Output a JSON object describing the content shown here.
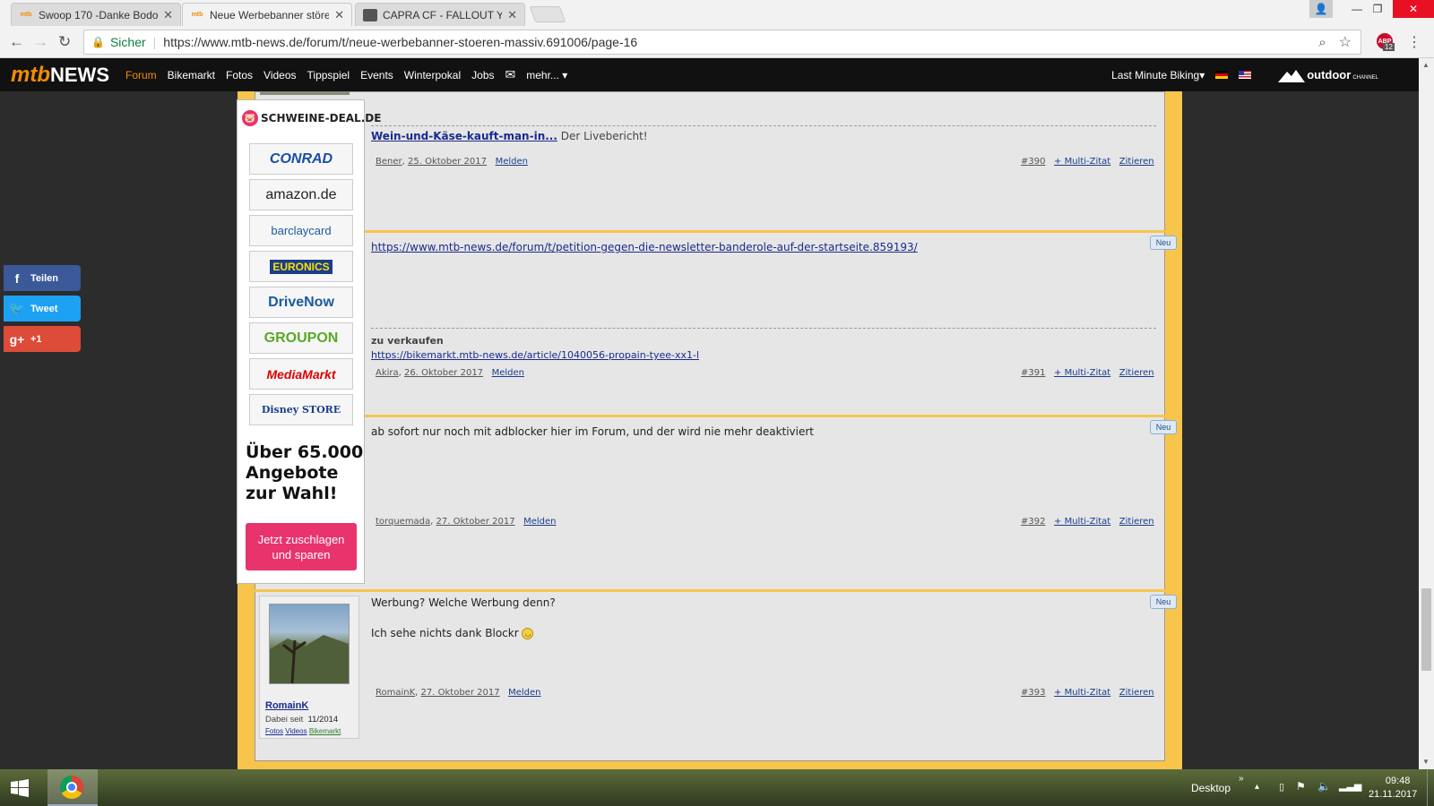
{
  "tabs": [
    {
      "title": "Swoop 170 -Danke Bodo",
      "icon": "mtb-icon",
      "active": false
    },
    {
      "title": "Neue Werbebanner störe",
      "icon": "mtb-icon",
      "active": true
    },
    {
      "title": "CAPRA CF - FALLOUT YE",
      "icon": "page-icon",
      "active": false
    }
  ],
  "address": {
    "secure_label": "Sicher",
    "url": "https://www.mtb-news.de/forum/t/neue-werbebanner-stoeren-massiv.691006/page-16",
    "abp_badge": "12"
  },
  "site_nav": {
    "logo_part1": "mtb",
    "logo_part2": "NEWS",
    "items": [
      "Forum",
      "Bikemarkt",
      "Fotos",
      "Videos",
      "Tippspiel",
      "Events",
      "Winterpokal",
      "Jobs"
    ],
    "more": "mehr...",
    "right_link": "Last Minute Biking",
    "outdoor": "outdoor",
    "outdoor_sub": "CHANNEL"
  },
  "social": [
    {
      "label": "Teilen",
      "icon": "facebook-icon",
      "glyph": "f",
      "color": "#3b5998"
    },
    {
      "label": "Tweet",
      "icon": "twitter-icon",
      "glyph": "🐦",
      "color": "#1da1f2"
    },
    {
      "label": "+1",
      "icon": "googleplus-icon",
      "glyph": "g+",
      "color": "#dd4b39"
    }
  ],
  "ad": {
    "header": "SCHWEINE-DEAL.DE",
    "brands": [
      "CONRAD",
      "amazon.de",
      "barclaycard",
      "EURONICS",
      "DriveNow",
      "GROUPON",
      "MediaMarkt",
      "Disney STORE"
    ],
    "headline_1": "Über 65.000",
    "headline_2": "Angebote",
    "headline_3": "zur Wahl!",
    "cta": "Jetzt zuschlagen und sparen"
  },
  "posts": [
    {
      "sig_link": "Wein-und-Käse-kauft-man-in...",
      "sig_text": "Der Livebericht!",
      "author": "Bener",
      "date": "25. Oktober 2017",
      "report": "Melden",
      "number": "#390",
      "multi": "+ Multi-Zitat",
      "quote": "Zitieren"
    },
    {
      "badge": "Neu",
      "link": "https://www.mtb-news.de/forum/t/petition-gegen-die-newsletter-banderole-auf-der-startseite.859193/",
      "sig_title": "zu verkaufen",
      "sig_link": "https://bikemarkt.mtb-news.de/article/1040056-propain-tyee-xx1-l",
      "author": "Akira",
      "date": "26. Oktober 2017",
      "report": "Melden",
      "number": "#391",
      "multi": "+ Multi-Zitat",
      "quote": "Zitieren"
    },
    {
      "badge": "Neu",
      "text": "ab sofort nur noch mit adblocker hier im Forum, und der wird nie mehr deaktiviert",
      "author": "torquemada",
      "date": "27. Oktober 2017",
      "report": "Melden",
      "number": "#392",
      "multi": "+ Multi-Zitat",
      "quote": "Zitieren"
    },
    {
      "badge": "Neu",
      "line1": "Werbung? Welche Werbung denn?",
      "line2": "Ich sehe nichts dank Blockr",
      "author": "RomainK",
      "date": "27. Oktober 2017",
      "report": "Melden",
      "number": "#393",
      "multi": "+ Multi-Zitat",
      "quote": "Zitieren",
      "user_name": "RomainK",
      "joined_label": "Dabei seit",
      "joined_value": "11/2014",
      "user_links": [
        "Fotos",
        "Videos",
        "Bikemarkt"
      ]
    }
  ],
  "taskbar": {
    "desktop": "Desktop",
    "time": "09:48",
    "date": "21.11.2017"
  },
  "colors": {
    "accent": "#f7c54b",
    "nav_bg": "#111111",
    "forum_active": "#f28c00",
    "cta": "#e8336d"
  }
}
